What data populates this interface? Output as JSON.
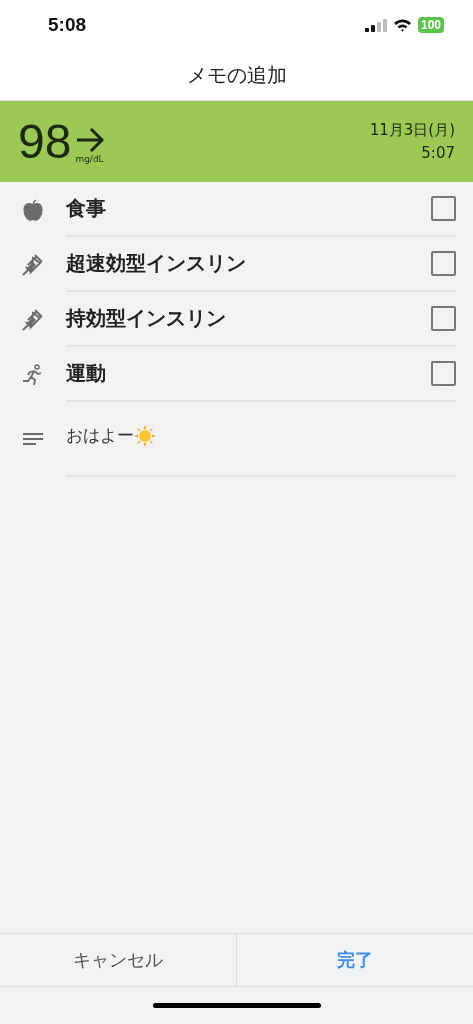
{
  "status_bar": {
    "time": "5:08",
    "battery": "100"
  },
  "title": "メモの追加",
  "reading": {
    "value": "98",
    "unit": "mg/dL",
    "date": "11月3日(月)",
    "time": "5:07"
  },
  "items": [
    {
      "kind": "food",
      "label": "食事",
      "checked": false
    },
    {
      "kind": "rapid-insulin",
      "label": "超速効型インスリン",
      "checked": false
    },
    {
      "kind": "long-insulin",
      "label": "持効型インスリン",
      "checked": false
    },
    {
      "kind": "exercise",
      "label": "運動",
      "checked": false
    }
  ],
  "note": {
    "text": "おはよー"
  },
  "buttons": [
    {
      "kind": "cancel",
      "label": "キャンセル"
    },
    {
      "kind": "done",
      "label": "完了"
    }
  ]
}
